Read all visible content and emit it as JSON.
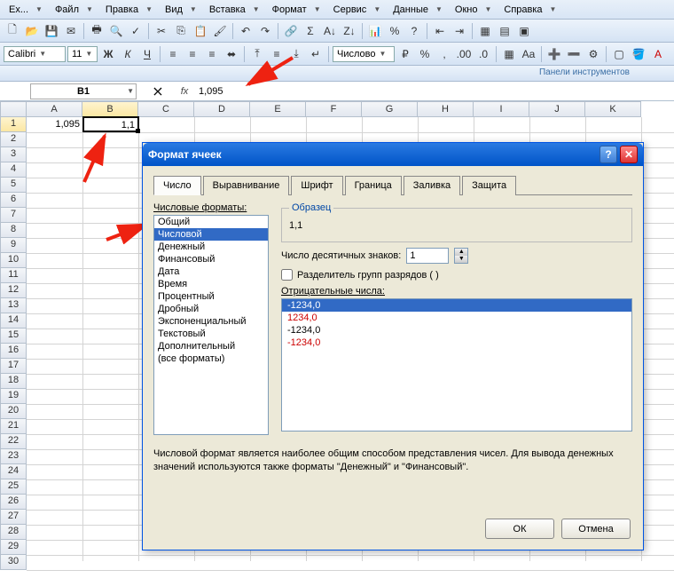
{
  "menu": {
    "items": [
      "Ex...",
      "Файл",
      "Правка",
      "Вид",
      "Вставка",
      "Формат",
      "Сервис",
      "Данные",
      "Окно",
      "Справка"
    ]
  },
  "toolbar2": {
    "font": "Calibri",
    "size": "11",
    "format_combo": "Числово"
  },
  "toolbar_label": "Панели инструментов",
  "namebox": "B1",
  "formula": "1,095",
  "cols": [
    "A",
    "B",
    "C",
    "D",
    "E",
    "F",
    "G",
    "H",
    "I",
    "J",
    "K"
  ],
  "cells": {
    "A1": "1,095",
    "B1": "1,1"
  },
  "dialog": {
    "title": "Формат ячеек",
    "tabs": [
      "Число",
      "Выравнивание",
      "Шрифт",
      "Граница",
      "Заливка",
      "Защита"
    ],
    "list_label": "Числовые форматы:",
    "formats": [
      "Общий",
      "Числовой",
      "Денежный",
      "Финансовый",
      "Дата",
      "Время",
      "Процентный",
      "Дробный",
      "Экспоненциальный",
      "Текстовый",
      "Дополнительный",
      "(все форматы)"
    ],
    "sample_label": "Образец",
    "sample_value": "1,1",
    "decimals_label": "Число десятичных знаков:",
    "decimals_value": "1",
    "thousands_label": "Разделитель групп разрядов ( )",
    "neg_label": "Отрицательные числа:",
    "neg": [
      "-1234,0",
      "1234,0",
      "-1234,0",
      "-1234,0"
    ],
    "desc": "Числовой формат является наиболее общим способом представления чисел. Для вывода денежных значений используются также форматы \"Денежный\" и \"Финансовый\".",
    "ok": "ОК",
    "cancel": "Отмена"
  }
}
